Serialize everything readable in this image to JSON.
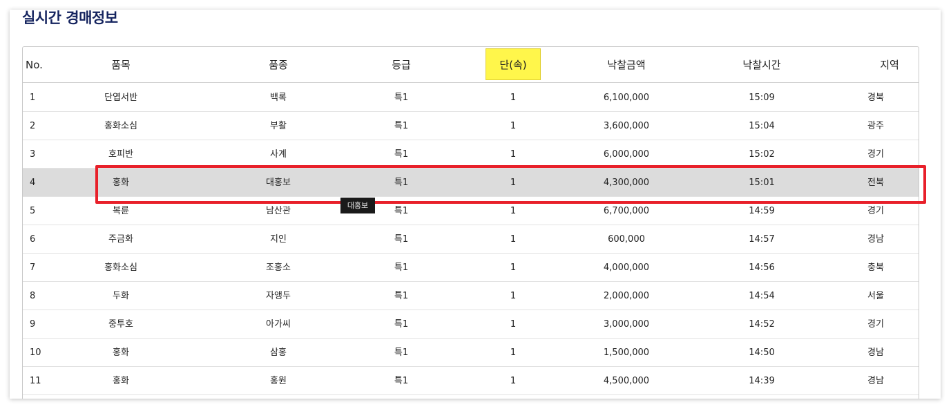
{
  "title": "실시간 경매정보",
  "headers": [
    "No.",
    "품목",
    "품종",
    "등급",
    "단(속)",
    "낙찰금액",
    "낙찰시간",
    "지역"
  ],
  "highlight_color": "#fff64b",
  "selection_color": "#e8202a",
  "rows": [
    {
      "no": "1",
      "item": "단엽서반",
      "variety": "백록",
      "grade": "특1",
      "unit": "1",
      "price": "6,100,000",
      "time": "15:09",
      "region": "경북"
    },
    {
      "no": "2",
      "item": "홍화소심",
      "variety": "부활",
      "grade": "특1",
      "unit": "1",
      "price": "3,600,000",
      "time": "15:04",
      "region": "광주"
    },
    {
      "no": "3",
      "item": "호피반",
      "variety": "사계",
      "grade": "특1",
      "unit": "1",
      "price": "6,000,000",
      "time": "15:02",
      "region": "경기"
    },
    {
      "no": "4",
      "item": "홍화",
      "variety": "대홍보",
      "grade": "특1",
      "unit": "1",
      "price": "4,300,000",
      "time": "15:01",
      "region": "전북"
    },
    {
      "no": "5",
      "item": "복륜",
      "variety": "남산관",
      "grade": "특1",
      "unit": "1",
      "price": "6,700,000",
      "time": "14:59",
      "region": "경기"
    },
    {
      "no": "6",
      "item": "주금화",
      "variety": "지인",
      "grade": "특1",
      "unit": "1",
      "price": "600,000",
      "time": "14:57",
      "region": "경남"
    },
    {
      "no": "7",
      "item": "홍화소심",
      "variety": "조홍소",
      "grade": "특1",
      "unit": "1",
      "price": "4,000,000",
      "time": "14:56",
      "region": "충북"
    },
    {
      "no": "8",
      "item": "두화",
      "variety": "자앵두",
      "grade": "특1",
      "unit": "1",
      "price": "2,000,000",
      "time": "14:54",
      "region": "서울"
    },
    {
      "no": "9",
      "item": "중투호",
      "variety": "아가씨",
      "grade": "특1",
      "unit": "1",
      "price": "3,000,000",
      "time": "14:52",
      "region": "경기"
    },
    {
      "no": "10",
      "item": "홍화",
      "variety": "삼홍",
      "grade": "특1",
      "unit": "1",
      "price": "1,500,000",
      "time": "14:50",
      "region": "경남"
    },
    {
      "no": "11",
      "item": "홍화",
      "variety": "홍원",
      "grade": "특1",
      "unit": "1",
      "price": "4,500,000",
      "time": "14:39",
      "region": "경남"
    }
  ],
  "selected_row_index": 3,
  "tooltip": "대홍보"
}
